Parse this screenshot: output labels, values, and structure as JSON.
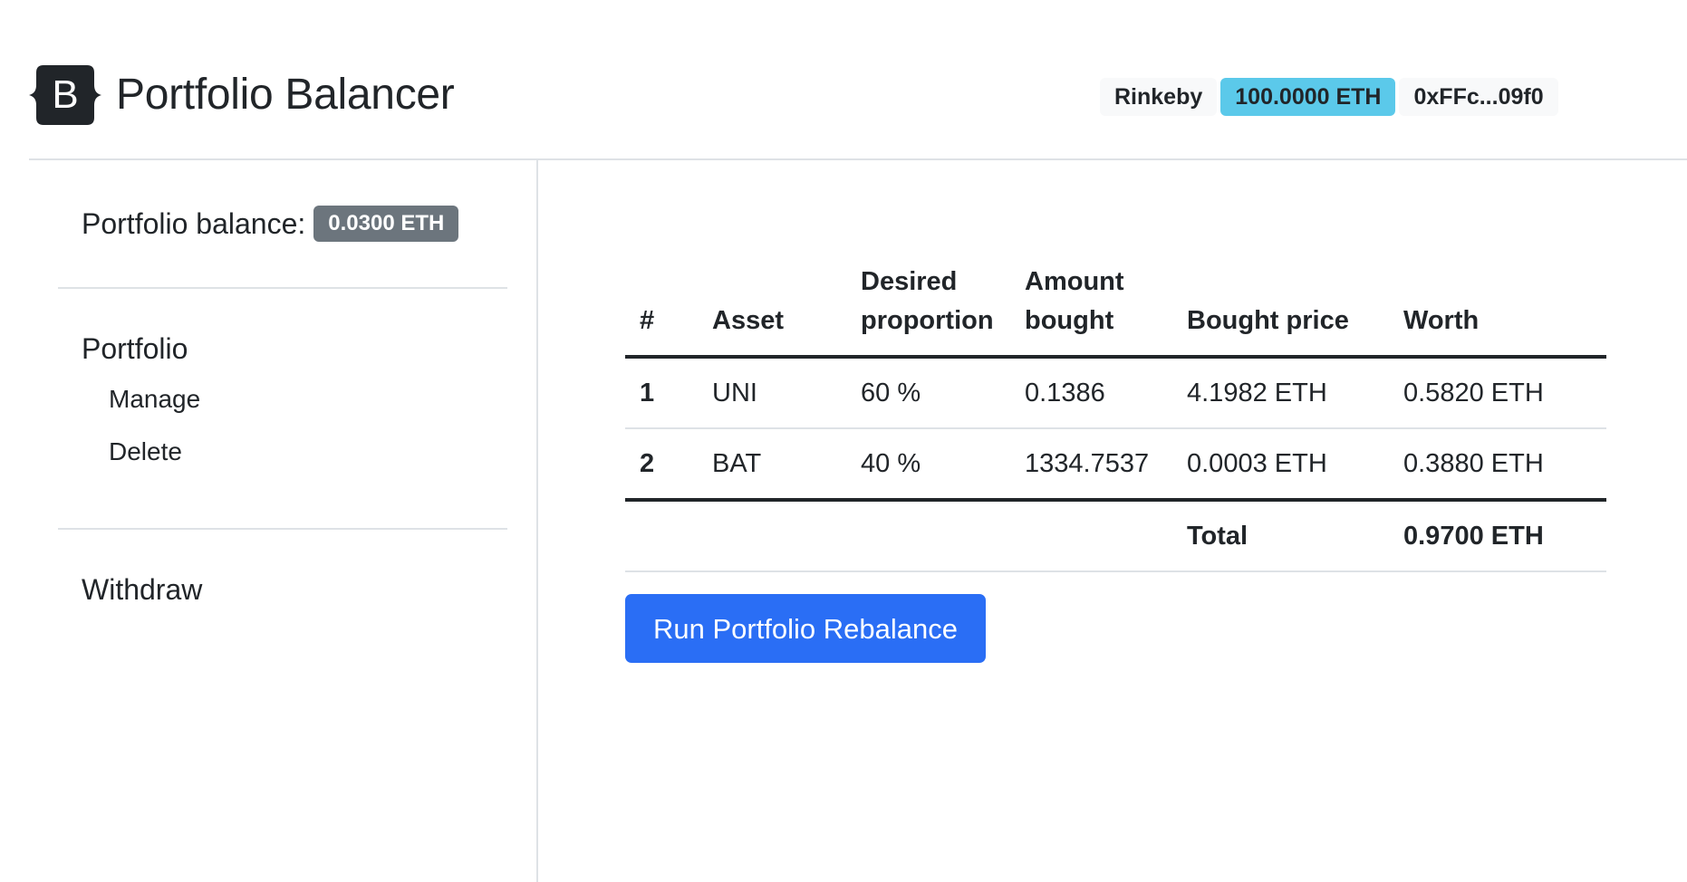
{
  "header": {
    "brand_letter": "B",
    "title": "Portfolio Balancer",
    "network": "Rinkeby",
    "wallet_balance": "100.0000 ETH",
    "address": "0xFFc...09f0"
  },
  "sidebar": {
    "balance_label": "Portfolio balance:",
    "balance_value": "0.0300 ETH",
    "portfolio_label": "Portfolio",
    "manage_label": "Manage",
    "delete_label": "Delete",
    "withdraw_label": "Withdraw"
  },
  "table": {
    "columns": {
      "num": "#",
      "asset": "Asset",
      "desired_1": "Desired",
      "desired_2": "proportion",
      "amount_1": "Amount",
      "amount_2": "bought",
      "price": "Bought price",
      "worth": "Worth"
    },
    "rows": [
      {
        "num": "1",
        "asset": "UNI",
        "proportion": "60 %",
        "amount": "0.1386",
        "price": "4.1982 ETH",
        "worth": "0.5820 ETH"
      },
      {
        "num": "2",
        "asset": "BAT",
        "proportion": "40 %",
        "amount": "1334.7537",
        "price": "0.0003 ETH",
        "worth": "0.3880 ETH"
      }
    ],
    "total_label": "Total",
    "total_value": "0.9700 ETH"
  },
  "actions": {
    "rebalance_label": "Run Portfolio Rebalance"
  },
  "colors": {
    "primary": "#2a6ef5",
    "info": "#5bc9ea",
    "secondary": "#6c757d",
    "light": "#f8f9fa",
    "text": "#212529",
    "border": "#dee2e6"
  }
}
